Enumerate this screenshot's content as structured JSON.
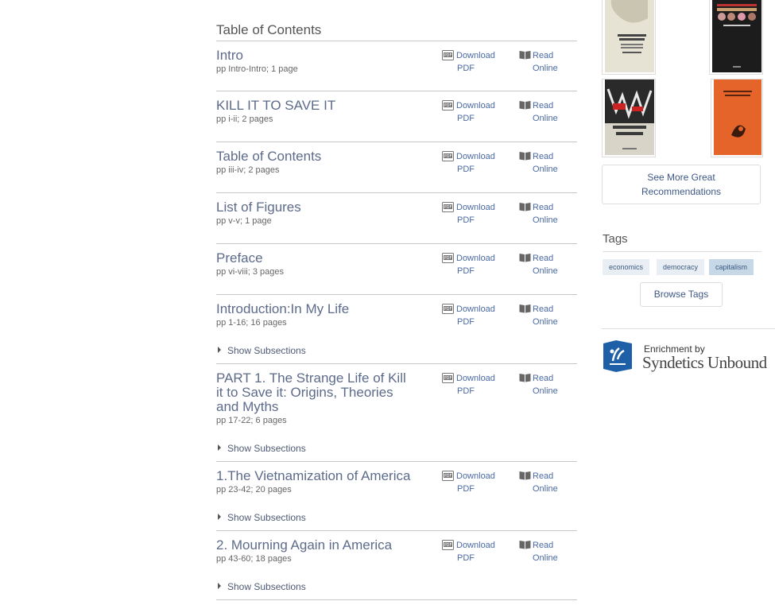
{
  "toc": {
    "heading": "Table of Contents",
    "download_label_1": "Download",
    "download_label_2": "PDF",
    "read_label_1": "Read",
    "read_label_2": "Online",
    "show_subsections_label": "Show Subsections",
    "entries": [
      {
        "title": "Intro",
        "pages": "pp Intro-Intro; 1 page"
      },
      {
        "title": "KILL IT TO SAVE IT",
        "pages": "pp i-ii; 2 pages"
      },
      {
        "title": "Table of Contents",
        "pages": "pp iii-iv; 2 pages"
      },
      {
        "title": "List of Figures",
        "pages": "pp v-v; 1 page"
      },
      {
        "title": "Preface",
        "pages": "pp vi-viii; 3 pages"
      },
      {
        "title": "Introduction:In My Life",
        "pages": "pp 1-16; 16 pages"
      },
      {
        "title": "PART 1. The Strange Life of Kill it to Save it: Origins, Theories and Myths",
        "pages": "pp 17-22; 6 pages"
      },
      {
        "title": "1.The Vietnamization of America",
        "pages": "pp 23-42; 20 pages"
      },
      {
        "title": "2. Mourning Again in America",
        "pages": "pp 43-60; 18 pages"
      }
    ]
  },
  "recommendations": {
    "covers": [
      {
        "name": "The Great Transformation"
      },
      {
        "name": "A Brief History of Neoliberalism"
      },
      {
        "name": "Social Justice and the City"
      },
      {
        "name": "Capitalism and the Historians"
      }
    ],
    "see_more_label_1": "See More Great",
    "see_more_label_2": "Recommendations"
  },
  "tags": {
    "heading": "Tags",
    "items": [
      "economics",
      "democracy",
      "capitalism"
    ],
    "active": "capitalism",
    "browse_label": "Browse Tags"
  },
  "enrichment": {
    "by_label": "Enrichment by",
    "provider": "Syndetics Unbound"
  },
  "colors": {
    "title_link": "#5d6b8a",
    "action_link": "#4a6aa5",
    "tag_bg": "#e8eef3",
    "tag_active_bg": "#c6d8e6",
    "logo_blue": "#1f5fa8"
  },
  "icons": {
    "download": "pdf-icon",
    "read": "book-icon",
    "expand": "triangle-right-icon"
  }
}
